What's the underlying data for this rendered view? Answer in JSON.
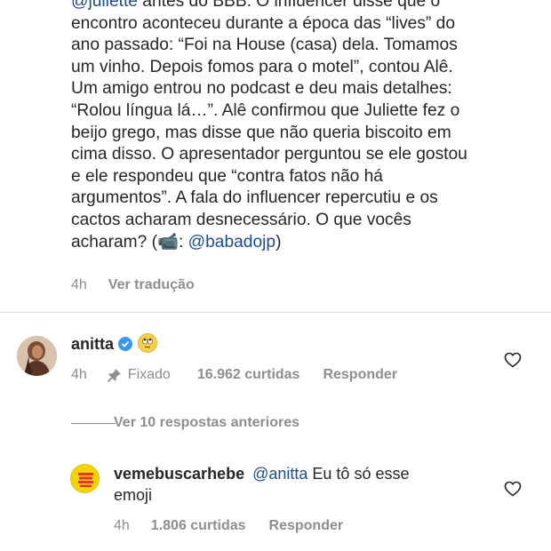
{
  "caption": {
    "lines": [
      "@juliette antes do BBB. O influencer disse que o",
      "encontro aconteceu durante a época das “lives” do",
      "ano passado: “Foi na House (casa) dela. Tomamos",
      "um vinho. Depois fomos para o motel”, contou Alê.",
      "Um amigo entrou no podcast e deu mais detalhes:",
      "“Rolou língua lá…”. Alê confirmou que Juliette fez o",
      "beijo grego, mas disse que não queria biscoito em",
      "cima disso. O apresentador perguntou se ele gostou",
      "e ele respondeu que “contra fatos não há",
      "argumentos”. A fala do influencer repercutiu e os",
      "cactos acharam desnecessário. O que vocês"
    ],
    "last_line_prefix": "acharam? (",
    "last_line_mention": "@babadojp",
    "last_line_suffix": ")",
    "camera_emoji": "📹",
    "mention_sep": ": ",
    "time": "4h",
    "translate_label": "Ver tradução"
  },
  "comment1": {
    "username": "anitta",
    "verified_icon": "verified-badge",
    "emoji": "rolling-eyes-emoji",
    "time": "4h",
    "pinned_label": "Fixado",
    "likes": "16.962 curtidas",
    "reply_label": "Responder"
  },
  "view_replies": "Ver 10 respostas anteriores",
  "comment2": {
    "username": "vemebuscarhebe",
    "mention": "@anitta",
    "text_line1": " Eu tô só esse",
    "text_line2": "emoji",
    "avatar_text": "VEM ME BUSCAR HEBE",
    "time": "4h",
    "likes": "1.806 curtidas",
    "reply_label": "Responder"
  },
  "colors": {
    "text": "#262626",
    "muted": "#8e8e8e",
    "mention": "#1f4d8c",
    "verified": "#3897f0",
    "avatar2_bg": "#f4d400",
    "avatar2_text": "#e3342f"
  }
}
